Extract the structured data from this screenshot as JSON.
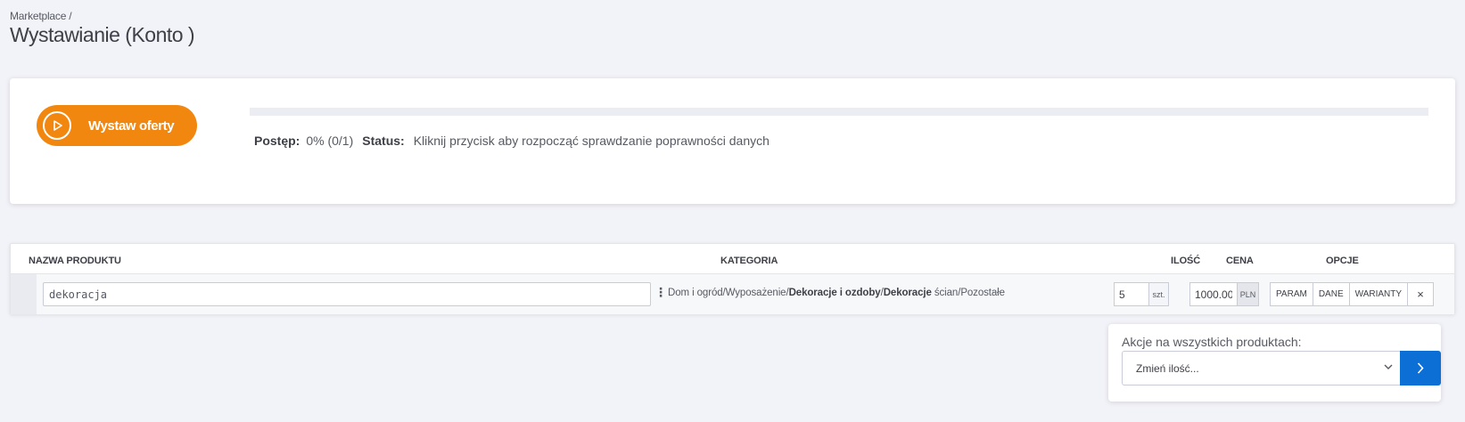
{
  "breadcrumb": "Marketplace /",
  "page_title": "Wystawianie (Konto )",
  "start_button": {
    "label": "Wystaw oferty",
    "icon": "play-circle-icon"
  },
  "progress": {
    "fraction": 0,
    "label_progress": "Postęp:",
    "value_progress": "0% (0/1)",
    "label_status": "Status:",
    "value_status": "Kliknij przycisk aby rozpocząć sprawdzanie poprawności danych"
  },
  "table": {
    "headers": {
      "name": "NAZWA PRODUKTU",
      "category": "KATEGORIA",
      "quantity": "ILOŚĆ",
      "price": "CENA",
      "options": "OPCJE"
    },
    "rows": [
      {
        "name": "dekoracja",
        "category_parts": [
          "Dom i ogród/Wyposażenie/",
          "Dekoracje i ozdoby",
          "/",
          "Dekoracje",
          " ścian/Pozostałe"
        ],
        "quantity": "5",
        "quantity_unit": "szt.",
        "price": "1000.00",
        "currency": "PLN",
        "option_buttons": [
          "PARAM",
          "DANE",
          "WARIANTY"
        ],
        "remove_label": "×"
      }
    ]
  },
  "bulk_actions": {
    "label": "Akcje na wszystkich produktach:",
    "selected": "Zmień ilość...",
    "go_icon": "chevron-right-icon"
  },
  "colors": {
    "accent_orange": "#f2870f",
    "primary_blue": "#0b6fd6",
    "background": "#f2f3f8"
  }
}
